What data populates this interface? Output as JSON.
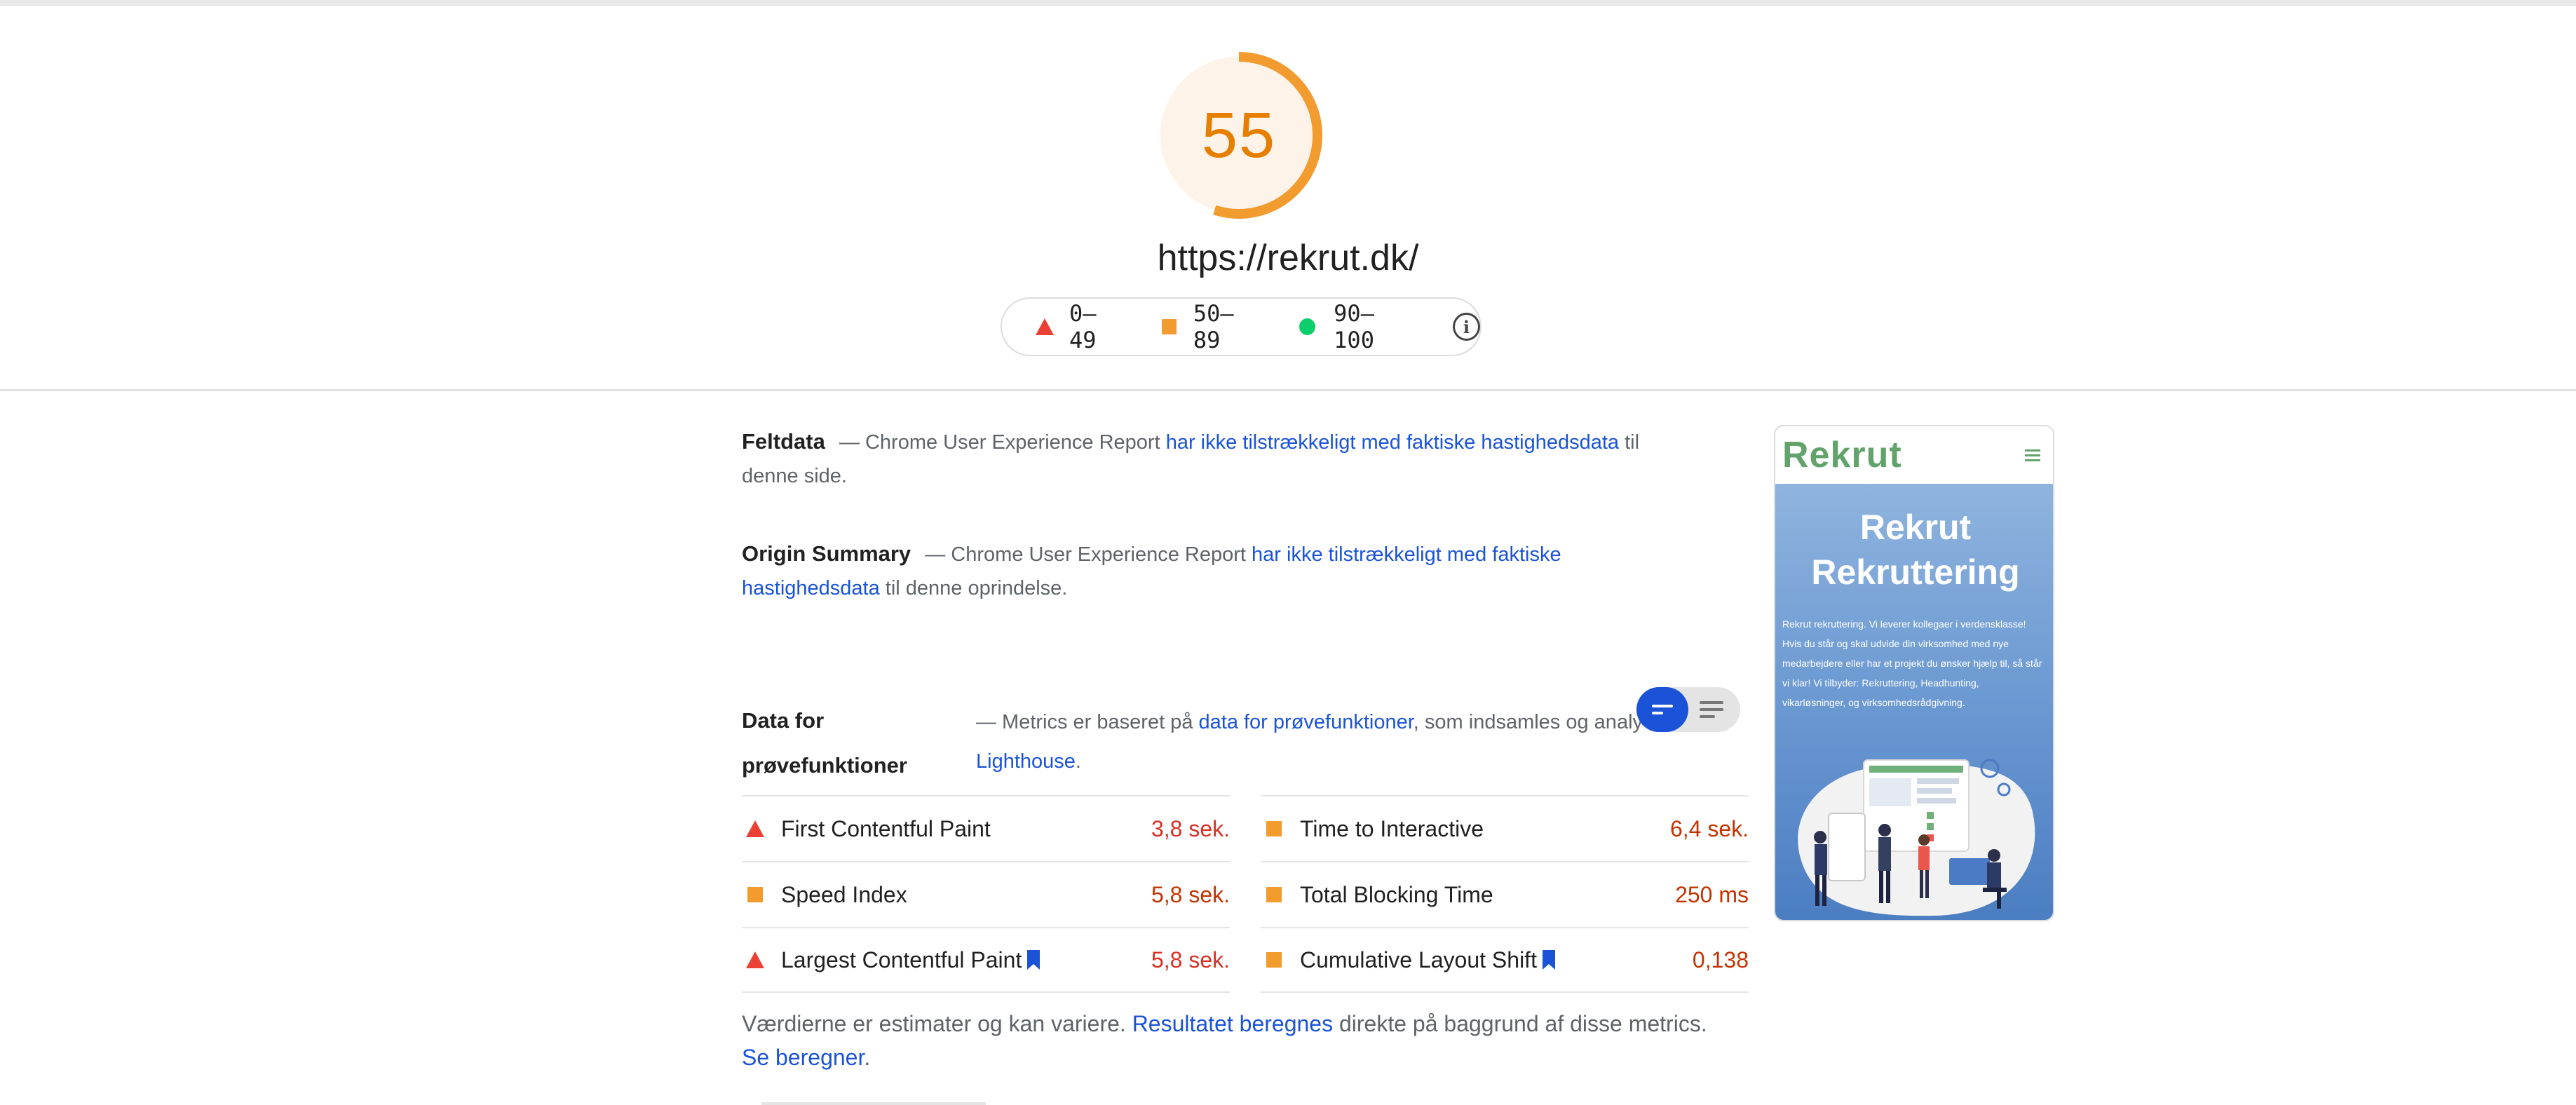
{
  "score": {
    "value": "55",
    "fraction": 0.55,
    "color": "#f29b2e",
    "background": "#fef3e8"
  },
  "url": "https://rekrut.dk/",
  "legend": {
    "fail": "0–49",
    "average": "50–89",
    "pass": "90–100",
    "info_icon": "info-icon"
  },
  "field_data": {
    "title": "Feltdata",
    "text_before": " — Chrome User Experience Report ",
    "link": "har ikke tilstrækkeligt med faktiske hastighedsdata",
    "text_after": " til denne side."
  },
  "origin_summary": {
    "title": "Origin Summary",
    "text_before": " — Chrome User Experience Report ",
    "link": "har ikke tilstrækkeligt med faktiske hastighedsdata",
    "text_after": " til denne oprindelse."
  },
  "lab_data": {
    "title_line1": "Data for",
    "title_line2": "prøvefunktioner",
    "desc_before": "— Metrics er baseret på ",
    "desc_link": "data for prøvefunktioner",
    "desc_after": ", som indsamles og analyseres af",
    "desc_link2": "Lighthouse",
    "desc_end": "."
  },
  "metrics": [
    {
      "label": "First Contentful Paint",
      "value": "3,8 sek.",
      "status": "fail",
      "bookmark": false
    },
    {
      "label": "Time to Interactive",
      "value": "6,4 sek.",
      "status": "average",
      "bookmark": false
    },
    {
      "label": "Speed Index",
      "value": "5,8 sek.",
      "status": "average",
      "bookmark": false
    },
    {
      "label": "Total Blocking Time",
      "value": "250 ms",
      "status": "average",
      "bookmark": false
    },
    {
      "label": "Largest Contentful Paint",
      "value": "5,8 sek.",
      "status": "fail",
      "bookmark": true
    },
    {
      "label": "Cumulative Layout Shift",
      "value": "0,138",
      "status": "average",
      "bookmark": true
    }
  ],
  "note": {
    "text1": "Værdierne er estimater og kan variere. ",
    "link1": "Resultatet beregnes",
    "text2": " direkte på baggrund af disse metrics. ",
    "link2": "Se beregner",
    "text3": "."
  },
  "thumbnail": {
    "logo": "Rekrut",
    "title_line1": "Rekrut",
    "title_line2": "Rekruttering",
    "body": "Rekrut rekruttering. Vi leverer kollegaer i verdensklasse! Hvis du står og skal udvide din virksomhed med nye medarbejdere eller har et projekt du ønsker hjælp til, så står vi klar! Vi tilbyder: Rekruttering, Headhunting, vikarløsninger, og virksomhedsrådgivning."
  },
  "colors": {
    "link": "#1a53d8",
    "fail": "#eb4034",
    "average": "#f29b2e",
    "pass": "#0cce6b",
    "fail_text": "#d93025",
    "average_text": "#c33300"
  }
}
